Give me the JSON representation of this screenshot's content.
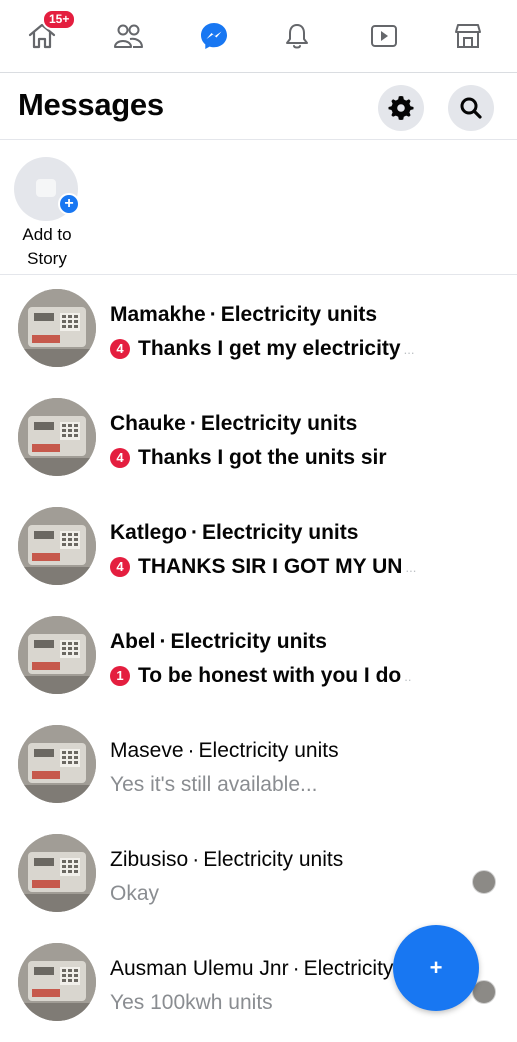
{
  "nav": {
    "home_badge": "15+",
    "icons": [
      "home-icon",
      "friends-icon",
      "messenger-icon",
      "bell-icon",
      "watch-icon",
      "marketplace-icon"
    ],
    "accent": "#1877f2"
  },
  "header": {
    "title": "Messages"
  },
  "story": {
    "label_line1": "Add to",
    "label_line2": "Story"
  },
  "conversations": [
    {
      "name": "Mamakhe",
      "separator": "·",
      "topic": "Electricity units",
      "unread_count": "4",
      "preview": "Thanks I get my electricity",
      "ellipsis": "...",
      "unread": true
    },
    {
      "name": "Chauke",
      "separator": "·",
      "topic": "Electricity units",
      "unread_count": "4",
      "preview": "Thanks I got the units sir",
      "ellipsis": "",
      "unread": true
    },
    {
      "name": "Katlego",
      "separator": "·",
      "topic": "Electricity units",
      "unread_count": "4",
      "preview": "THANKS SIR I GOT MY UN",
      "ellipsis": "...",
      "unread": true
    },
    {
      "name": "Abel",
      "separator": "·",
      "topic": "Electricity units",
      "unread_count": "1",
      "preview": "To be honest with you I do",
      "ellipsis": "..",
      "unread": true
    },
    {
      "name": "Maseve",
      "separator": "·",
      "topic": "Electricity units",
      "preview": "Yes it's still available...",
      "unread": false
    },
    {
      "name": "Zibusiso",
      "separator": "·",
      "topic": "Electricity units",
      "preview": "Okay",
      "unread": false
    },
    {
      "name": "Ausman Ulemu Jnr",
      "separator": "·",
      "topic": "Electricity units",
      "preview": "Yes 100kwh units",
      "unread": false
    }
  ],
  "fab": {
    "label": "+"
  },
  "colors": {
    "badge_red": "#e41e3f",
    "read_gray": "#8a8d91",
    "divider": "#e4e6eb"
  }
}
